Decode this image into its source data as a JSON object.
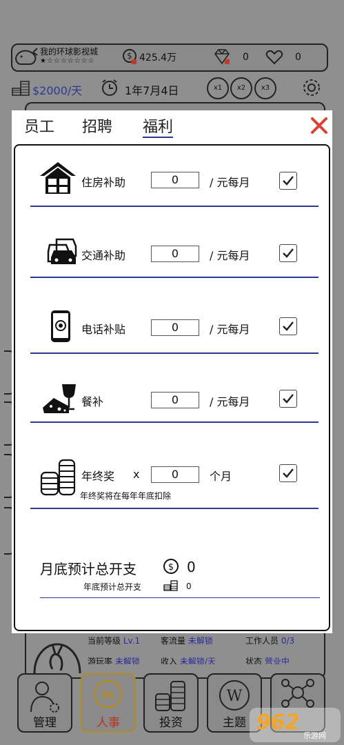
{
  "studio": {
    "name": "我的环球影视城",
    "stars": "★☆☆☆☆☆☆☆",
    "money": "425.4万",
    "gems": "0",
    "hearts": "0"
  },
  "status_bar": {
    "daily_cost": "$2000/天",
    "date": "1年7月4日",
    "speeds": [
      "x1",
      "x2",
      "x3"
    ]
  },
  "modal": {
    "tabs": [
      {
        "label": "员工"
      },
      {
        "label": "招聘"
      },
      {
        "label": "福利"
      }
    ],
    "active_tab": "福利",
    "benefits": [
      {
        "icon": "house-icon",
        "label": "住房补助",
        "value": "0",
        "unit": "/ 元每月",
        "checked": true
      },
      {
        "icon": "cars-icon",
        "label": "交通补助",
        "value": "0",
        "unit": "/ 元每月",
        "checked": true
      },
      {
        "icon": "phone-icon",
        "label": "电话补贴",
        "value": "0",
        "unit": "/ 元每月",
        "checked": true
      },
      {
        "icon": "meal-icon",
        "label": "餐补",
        "value": "0",
        "unit": "/ 元每月",
        "checked": true
      },
      {
        "icon": "coins-icon",
        "label": "年终奖",
        "multiplier": "x",
        "value": "0",
        "unit": "个月",
        "checked": true,
        "note": "年终奖将在每年年底扣除"
      }
    ],
    "summary": {
      "monthly_label": "月底预计总开支",
      "monthly_value": "0",
      "yearly_label": "年底预计总开支",
      "yearly_value": "0"
    }
  },
  "footer_info": {
    "level_label": "当前等级",
    "level_value": "Lv.1",
    "traffic_label": "客流量",
    "traffic_value": "未解锁",
    "staff_label": "工作人员",
    "staff_value": "0/3",
    "play_label": "游玩率",
    "play_value": "未解锁",
    "income_label": "收入",
    "income_value": "未解锁/天",
    "state_label": "状态",
    "state_value": "营业中"
  },
  "bottom_nav": [
    {
      "label": "管理"
    },
    {
      "label": "人事"
    },
    {
      "label": "投资"
    },
    {
      "label": "主题"
    },
    {
      "label": ""
    }
  ],
  "watermark": {
    "number": "962",
    "text": "乐游网"
  },
  "colors": {
    "accent": "#2b3a8f",
    "close": "#e0402f",
    "active_nav": "#b6361f"
  }
}
